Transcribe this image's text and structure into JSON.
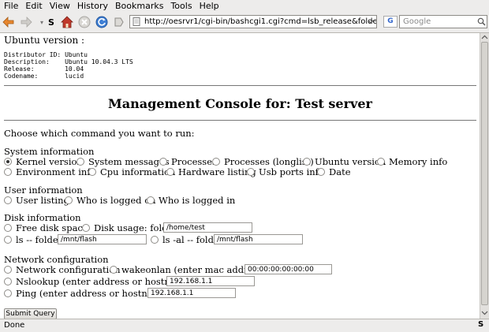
{
  "menu": [
    "File",
    "Edit",
    "View",
    "History",
    "Bookmarks",
    "Tools",
    "Help"
  ],
  "url": "http://oesrvr1/cgi-bin/bashcgi1.cgi?cmd=lsb_release&folder3=%2Fh",
  "search_placeholder": "Google",
  "status": "Done",
  "output": {
    "heading": "Ubuntu version :",
    "lines": [
      "Distributor ID:\tUbuntu",
      "Description:\tUbuntu 10.04.3 LTS",
      "Release:\t10.04",
      "Codename:\tlucid"
    ]
  },
  "page_title": "Management Console for: Test server",
  "prompt": "Choose which command you want to run:",
  "sections": {
    "system": {
      "label": "System information",
      "options": [
        "Kernel version",
        "System messages",
        "Processes",
        "Processes (longlist)",
        "Ubuntu version",
        "Memory info",
        "Environment info",
        "Cpu information",
        "Hardware listing",
        "Usb ports info",
        "Date"
      ]
    },
    "user": {
      "label": "User information",
      "options": [
        "User listing",
        "Who is logged on",
        "Who is logged in"
      ]
    },
    "disk": {
      "label": "Disk information",
      "options": [
        "Free disk space",
        "Disk usage: folder",
        "ls -- folder",
        "ls -al -- folder"
      ],
      "values": [
        "/home/test",
        "/mnt/flash",
        "/mnt/flash"
      ]
    },
    "network": {
      "label": "Network configuration",
      "options": [
        "Network configuration",
        "wakeonlan (enter mac address)",
        "Nslookup (enter address or hostname)",
        "Ping (enter address or hostname)"
      ],
      "values": [
        "00:00:00:00:00:00",
        "192.168.1.1",
        "192.168.1.1"
      ]
    }
  },
  "submit_label": "Submit Query"
}
